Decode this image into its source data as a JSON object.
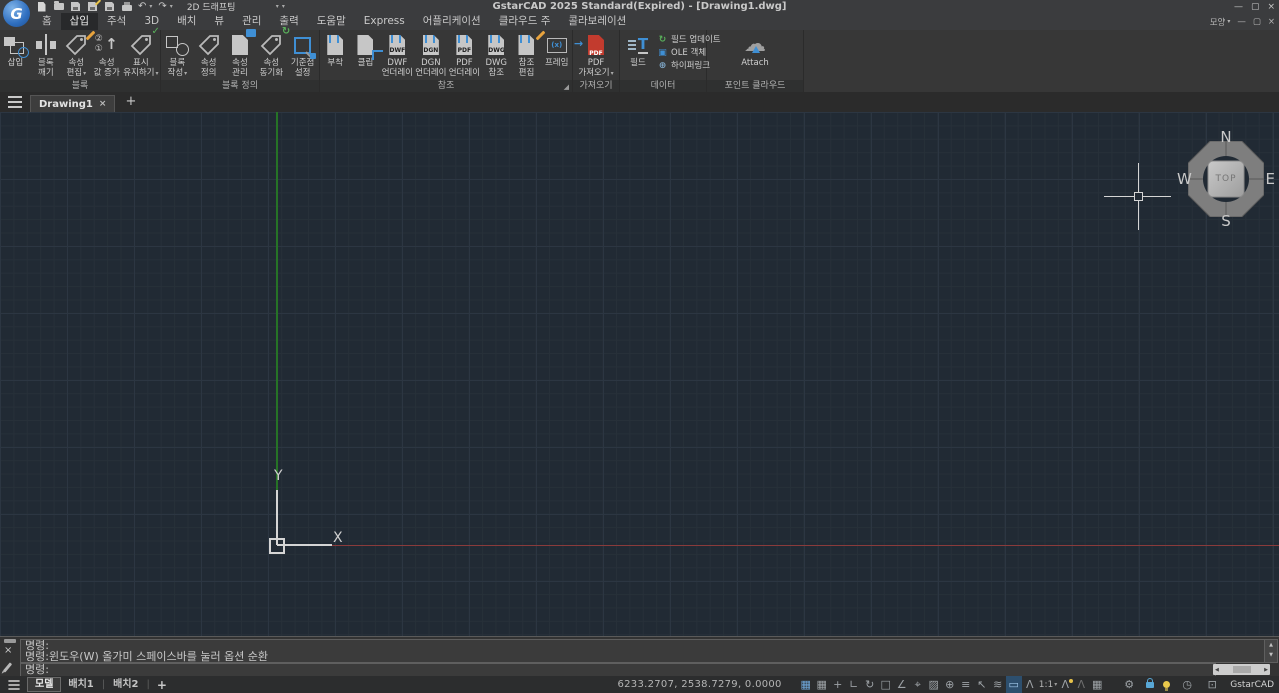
{
  "glyphs": {
    "caret_down": "▾",
    "close": "×",
    "minimize": "—",
    "restore": "▢",
    "plus": "+",
    "launcher": "◢",
    "up": "▲",
    "down": "▼",
    "left": "◀",
    "right": "▶",
    "undo": "↶",
    "redo": "↷"
  },
  "window": {
    "title": "GstarCAD 2025 Standard(Expired) - [Drawing1.dwg]",
    "brand_letter": "G"
  },
  "quick_access": {
    "workspace": "2D 드래프팅",
    "icons": [
      {
        "name": "new-file-icon"
      },
      {
        "name": "open-file-icon"
      },
      {
        "name": "save-icon"
      },
      {
        "name": "save-as-icon"
      },
      {
        "name": "save-all-icon"
      },
      {
        "name": "print-icon"
      },
      {
        "name": "undo-icon",
        "glyph": "↶"
      },
      {
        "name": "redo-icon",
        "glyph": "↷"
      }
    ]
  },
  "menu": {
    "appearance": "모양",
    "tabs": [
      {
        "label": "홈"
      },
      {
        "label": "삽입",
        "active": true
      },
      {
        "label": "주석"
      },
      {
        "label": "3D"
      },
      {
        "label": "배치"
      },
      {
        "label": "뷰"
      },
      {
        "label": "관리"
      },
      {
        "label": "출력"
      },
      {
        "label": "도움말"
      },
      {
        "label": "Express"
      },
      {
        "label": "어플리케이션"
      },
      {
        "label": "클라우드 주"
      },
      {
        "label": "콜라보레이션"
      }
    ]
  },
  "ribbon": {
    "groups": [
      {
        "label": "블록",
        "buttons": [
          {
            "icon": "insert-block-icon",
            "l1": "삽입"
          },
          {
            "icon": "explode-block-icon",
            "l1": "블록",
            "l2": "깨기"
          },
          {
            "icon": "edit-attribute-icon",
            "l1": "속성",
            "l2": "편집",
            "arrow": "▾"
          },
          {
            "icon": "increment-attribute-icon",
            "l1": "속성",
            "l2": "값 증가",
            "n1": "①",
            "n2": "②",
            "overlay": "↑"
          },
          {
            "icon": "keep-display-icon",
            "l1": "표시",
            "l2": "유지하기",
            "arrow": "▾",
            "overlay": "✓"
          }
        ]
      },
      {
        "label": "블록 정의",
        "buttons": [
          {
            "icon": "create-block-icon",
            "l1": "블록",
            "l2": "작성",
            "arrow": "▾"
          },
          {
            "icon": "define-attribute-icon",
            "l1": "속성",
            "l2": "정의"
          },
          {
            "icon": "manage-attributes-icon",
            "l1": "속성",
            "l2": "관리"
          },
          {
            "icon": "sync-attributes-icon",
            "l1": "속성",
            "l2": "동기화",
            "overlay": "↻"
          },
          {
            "icon": "set-basepoint-icon",
            "l1": "기준점",
            "l2": "설정"
          }
        ]
      },
      {
        "label": "참조",
        "launcher": "◢",
        "buttons": [
          {
            "icon": "attach-reference-icon",
            "l1": "부착"
          },
          {
            "icon": "clip-icon",
            "l1": "클립"
          },
          {
            "icon": "dwf-underlay-icon",
            "badge": "DWF",
            "l1": "DWF",
            "l2": "언더레이"
          },
          {
            "icon": "dgn-underlay-icon",
            "badge": "DGN",
            "l1": "DGN",
            "l2": "언더레이"
          },
          {
            "icon": "pdf-underlay-icon",
            "badge": "PDF",
            "l1": "PDF",
            "l2": "언더레이"
          },
          {
            "icon": "dwg-xref-icon",
            "badge": "DWG",
            "l1": "DWG",
            "l2": "참조"
          },
          {
            "icon": "edit-reference-icon",
            "l1": "참조",
            "l2": "편집"
          },
          {
            "icon": "frame-icon",
            "inner": "(x)",
            "l1": "프레임"
          }
        ]
      },
      {
        "label": "가져오기",
        "buttons": [
          {
            "icon": "pdf-import-icon",
            "badge": "PDF",
            "l1": "PDF",
            "l2": "가져오기",
            "arrow": "▾",
            "overlay": "→"
          }
        ]
      },
      {
        "label": "데이터",
        "big": {
          "icon": "field-icon",
          "letter": "T",
          "l1": "필드"
        },
        "items": [
          {
            "icon": "update-field-icon",
            "glyph": "↻",
            "label": "필드 업데이트"
          },
          {
            "icon": "ole-object-icon",
            "glyph": "▣",
            "label": "OLE 객체"
          },
          {
            "icon": "hyperlink-icon",
            "glyph": "⊕",
            "label": "하이퍼링크"
          }
        ]
      },
      {
        "label": "포인트 클라우드",
        "buttons": [
          {
            "icon": "point-cloud-attach-icon",
            "l1": "Attach"
          }
        ]
      }
    ]
  },
  "document_tabs": {
    "tabs": [
      {
        "label": "Drawing1",
        "active": true
      }
    ]
  },
  "viewcube": {
    "north": "N",
    "south": "S",
    "west": "W",
    "east": "E",
    "top": "TOP"
  },
  "ucs": {
    "x_label": "X",
    "y_label": "Y"
  },
  "command_line": {
    "history": [
      "명령:",
      "명령:윈도우(W) 올가미   스페이스바를 눌러 옵션 순환"
    ],
    "prompt": "명령:"
  },
  "status_bar": {
    "layout_tabs": [
      {
        "label": "모델",
        "active": true
      },
      {
        "label": "배치1"
      },
      {
        "label": "배치2"
      }
    ],
    "coordinates": "6233.2707, 2538.7279, 0.0000",
    "icons": [
      {
        "name": "grid-display-icon",
        "glyph": "▦"
      },
      {
        "name": "snap-grid-icon",
        "glyph": "▦"
      },
      {
        "name": "snap-mode-icon",
        "glyph": "+"
      },
      {
        "name": "ortho-mode-icon",
        "glyph": "∟"
      },
      {
        "name": "polar-tracking-icon",
        "glyph": "↻"
      },
      {
        "name": "object-snap-icon",
        "glyph": "□"
      },
      {
        "name": "osnap-tracking-icon",
        "glyph": "∠"
      },
      {
        "name": "3d-osnap-icon",
        "glyph": "⌖"
      },
      {
        "name": "hatch-display-icon",
        "glyph": "▨"
      },
      {
        "name": "dynamic-input-icon",
        "glyph": "⊕"
      },
      {
        "name": "lineweight-icon",
        "glyph": "≡"
      },
      {
        "name": "quick-properties-icon",
        "glyph": "↖"
      },
      {
        "name": "layers-icon",
        "glyph": "≋"
      },
      {
        "name": "graphics-monitor-icon",
        "glyph": "▭"
      }
    ],
    "annotation": {
      "person": "Λ",
      "scale": "1:1"
    },
    "table_glyph": "▦",
    "gear_glyph": "⚙",
    "clock_glyph": "◷",
    "fullscreen_glyph": "⊡",
    "brand": "GstarCAD"
  }
}
